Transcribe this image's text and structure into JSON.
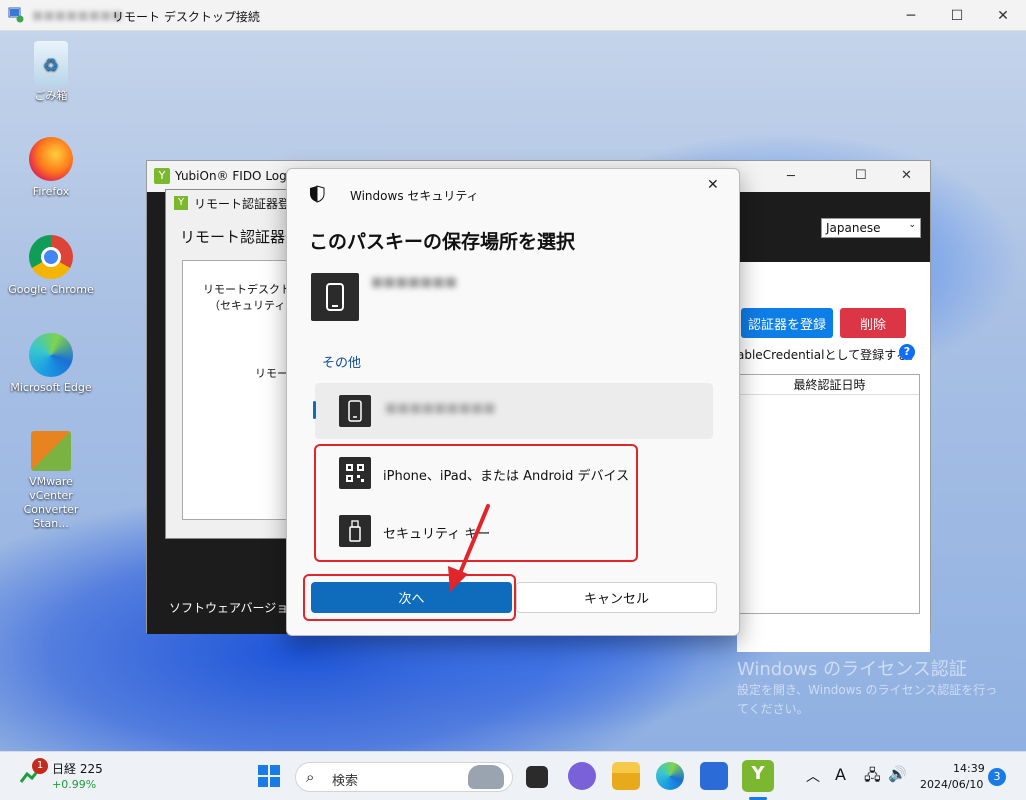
{
  "rdp": {
    "title": "リモート デスクトップ接続",
    "host_blurred": "■■■■■■■■"
  },
  "desktop": {
    "icons": [
      {
        "label": "ごみ箱",
        "icon": "recycle-bin-icon"
      },
      {
        "label": "Firefox",
        "icon": "firefox-icon"
      },
      {
        "label": "Google Chrome",
        "icon": "chrome-icon"
      },
      {
        "label": "Microsoft Edge",
        "icon": "edge-icon"
      },
      {
        "label": "VMware vCenter Converter Stan...",
        "icon": "vmware-icon"
      }
    ],
    "watermark_title": "Windows のライセンス認証",
    "watermark_text": "設定を開き、Windows のライセンス認証を行ってください。"
  },
  "app": {
    "title": "YubiOn® FIDO Logon",
    "subwindow_title": "リモート認証器登録",
    "subwindow_heading": "リモート認証器登録",
    "body_line1": "リモートデスクトップ",
    "body_line2": "（セキュリティキー",
    "body_line3": "リモート",
    "language": "Japanese",
    "register_button": "認証器を登録",
    "delete_button": "削除",
    "resident_text": "ableCredentialとして登録する。",
    "help_glyph": "?",
    "column_last_auth": "最終認証日時",
    "footer_version": "ソフトウェアバージョン"
  },
  "security_dialog": {
    "header": "Windows セキュリティ",
    "title": "このパスキーの保存場所を選択",
    "account_blurred": "■■■■■■■",
    "other_label": "その他",
    "device_blurred": "■■■■■■■■■",
    "option_phone": "iPhone、iPad、または Android デバイス",
    "option_key": "セキュリティ キー",
    "next_button": "次へ",
    "cancel_button": "キャンセル",
    "close_glyph": "✕"
  },
  "taskbar": {
    "stock_name": "日経 225",
    "stock_change": "+0.99%",
    "stock_badge": "1",
    "search_placeholder": "検索",
    "ime_glyph": "A",
    "time": "14:39",
    "date": "2024/06/10",
    "notification_count": "3"
  },
  "colors": {
    "accent_blue": "#0f6cbd",
    "annotation_red": "#e0262b",
    "delete_red": "#dc3545"
  }
}
